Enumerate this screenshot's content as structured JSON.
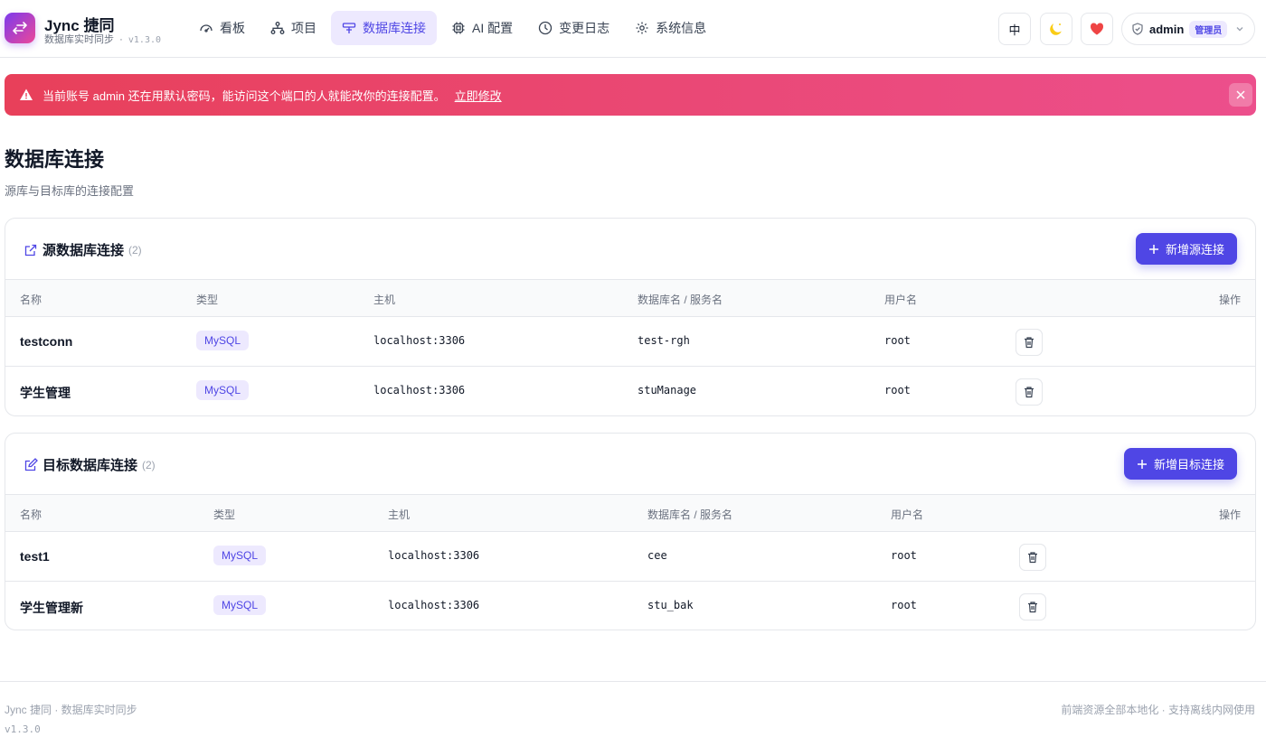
{
  "brand": {
    "title": "Jync 捷同",
    "subtitle": "数据库实时同步",
    "version": "v1.3.0",
    "accent": "#4f46e5"
  },
  "nav": [
    {
      "label": "看板",
      "icon": "dashboard-icon"
    },
    {
      "label": "项目",
      "icon": "sitemap-icon"
    },
    {
      "label": "数据库连接",
      "icon": "plug-icon",
      "active": true
    },
    {
      "label": "AI 配置",
      "icon": "chip-icon"
    },
    {
      "label": "变更日志",
      "icon": "clock-icon"
    },
    {
      "label": "系统信息",
      "icon": "gear-icon"
    }
  ],
  "header": {
    "lang": "中",
    "user": "admin",
    "role": "管理员"
  },
  "alert": {
    "message": "当前账号 admin 还在用默认密码，能访问这个端口的人就能改你的连接配置。",
    "action": "立即修改"
  },
  "page": {
    "title": "数据库连接",
    "subtitle": "源库与目标库的连接配置"
  },
  "source": {
    "title": "源数据库连接",
    "count": "(2)",
    "add_label": "新增源连接",
    "columns": [
      "名称",
      "类型",
      "主机",
      "数据库名 / 服务名",
      "用户名",
      "操作"
    ],
    "rows": [
      {
        "name": "testconn",
        "type": "MySQL",
        "host": "localhost:3306",
        "db": "test-rgh",
        "user": "root"
      },
      {
        "name": "学生管理",
        "type": "MySQL",
        "host": "localhost:3306",
        "db": "stuManage",
        "user": "root"
      }
    ]
  },
  "target": {
    "title": "目标数据库连接",
    "count": "(2)",
    "add_label": "新增目标连接",
    "columns": [
      "名称",
      "类型",
      "主机",
      "数据库名 / 服务名",
      "用户名",
      "操作"
    ],
    "rows": [
      {
        "name": "test1",
        "type": "MySQL",
        "host": "localhost:3306",
        "db": "cee",
        "user": "root"
      },
      {
        "name": "学生管理新",
        "type": "MySQL",
        "host": "localhost:3306",
        "db": "stu_bak",
        "user": "root"
      }
    ]
  },
  "footer": {
    "left": "Jync 捷同 · 数据库实时同步",
    "version": "v1.3.0",
    "right": "前端资源全部本地化 · 支持离线内网使用"
  }
}
